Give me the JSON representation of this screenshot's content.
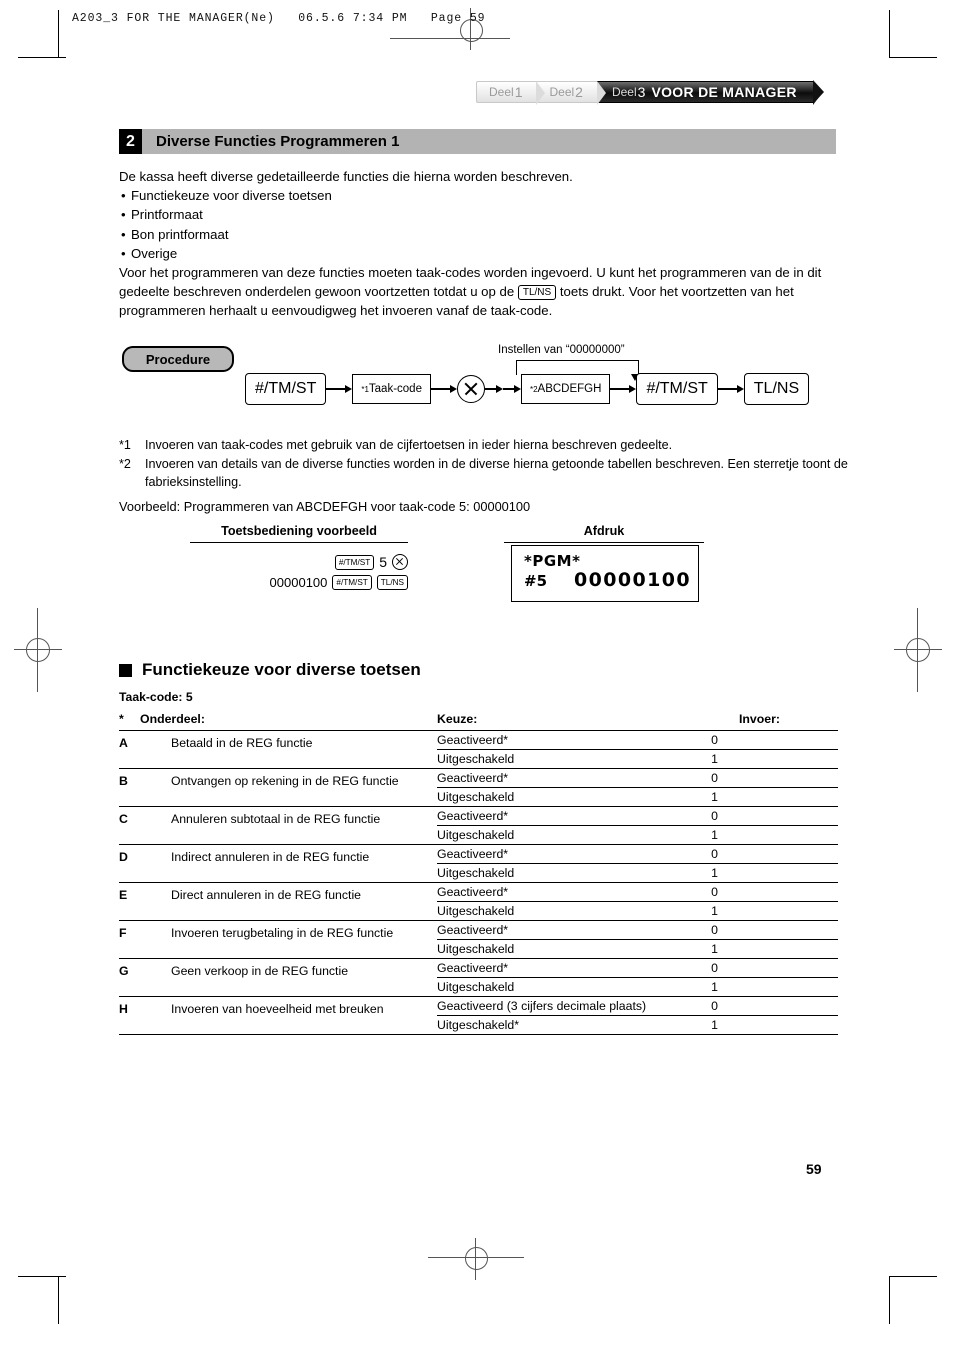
{
  "print_header": "A203_3 FOR THE MANAGER(Ne)   06.5.6 7:34 PM   Page 59",
  "header": {
    "tabs": [
      {
        "label": "Deel",
        "num": "1"
      },
      {
        "label": "Deel",
        "num": "2"
      },
      {
        "label": "Deel",
        "num": "3"
      }
    ],
    "title": "VOOR DE MANAGER"
  },
  "banner": {
    "number": "2",
    "title": "Diverse Functies Programmeren 1"
  },
  "intro": {
    "lead": "De kassa heeft diverse gedetailleerde functies die hierna worden beschreven.",
    "bullets": [
      "Functiekeuze voor diverse toetsen",
      "Printformaat",
      "Bon printformaat",
      "Overige"
    ],
    "para_1": "Voor het programmeren van deze functies moeten taak-codes worden ingevoerd. U kunt het programmeren van de in dit gedeelte beschreven onderdelen gewoon voortzetten totdat u op de",
    "key_tlns": "TL/NS",
    "para_2": "toets drukt. Voor het voortzetten van het programmeren herhaalt u eenvoudigweg het invoeren vanaf de taak-code."
  },
  "procedure": {
    "badge": "Procedure",
    "loop_label": "Instellen van “00000000”",
    "steps": {
      "step1": "#/TM/ST",
      "step2_sup": "*1",
      "step2": "Taak-code",
      "step3_icon": "multiply-circle-icon",
      "step4_sup": "*2",
      "step4": "ABCDEFGH",
      "step5": "#/TM/ST",
      "step6": "TL/NS"
    }
  },
  "notes": [
    {
      "mark": "*1",
      "text": "Invoeren van taak-codes met gebruik van de cijfertoetsen in ieder hierna beschreven gedeelte."
    },
    {
      "mark": "*2",
      "text": "Invoeren van details van de diverse functies worden in de diverse hierna getoonde tabellen beschreven. Een sterretje toont de fabrieksinstelling."
    }
  ],
  "voorbeeld": "Voorbeeld:  Programmeren van ABCDEFGH voor taak-code 5: 00000100",
  "example": {
    "left_heading": "Toetsbediening voorbeeld",
    "right_heading": "Afdruk",
    "keys_row1": [
      "#/TM/ST",
      "5",
      "multiply-circle-icon"
    ],
    "keys_row2_value": "00000100",
    "keys_row2": [
      "#/TM/ST",
      "TL/NS"
    ],
    "receipt": {
      "line1": "*PGM*",
      "line2_label": "#5",
      "line2_value": "00000100"
    }
  },
  "section": {
    "title": "Functiekeuze voor diverse toetsen",
    "taak_code_label": "Taak-code:",
    "taak_code_value": "5"
  },
  "table": {
    "headers": {
      "star": "*",
      "item": "Onderdeel:",
      "choice": "Keuze:",
      "entry": "Invoer:"
    },
    "rows": [
      {
        "letter": "A",
        "item": "Betaald in de REG functie",
        "options": [
          {
            "choice": "Geactiveerd*",
            "entry": "0"
          },
          {
            "choice": "Uitgeschakeld",
            "entry": "1"
          }
        ]
      },
      {
        "letter": "B",
        "item": "Ontvangen op rekening in de REG functie",
        "options": [
          {
            "choice": "Geactiveerd*",
            "entry": "0"
          },
          {
            "choice": "Uitgeschakeld",
            "entry": "1"
          }
        ]
      },
      {
        "letter": "C",
        "item": "Annuleren subtotaal in de REG functie",
        "options": [
          {
            "choice": "Geactiveerd*",
            "entry": "0"
          },
          {
            "choice": "Uitgeschakeld",
            "entry": "1"
          }
        ]
      },
      {
        "letter": "D",
        "item": "Indirect annuleren in de REG functie",
        "options": [
          {
            "choice": "Geactiveerd*",
            "entry": "0"
          },
          {
            "choice": "Uitgeschakeld",
            "entry": "1"
          }
        ]
      },
      {
        "letter": "E",
        "item": "Direct annuleren in de REG functie",
        "options": [
          {
            "choice": "Geactiveerd*",
            "entry": "0"
          },
          {
            "choice": "Uitgeschakeld",
            "entry": "1"
          }
        ]
      },
      {
        "letter": "F",
        "item": "Invoeren terugbetaling in de REG functie",
        "options": [
          {
            "choice": "Geactiveerd*",
            "entry": "0"
          },
          {
            "choice": "Uitgeschakeld",
            "entry": "1"
          }
        ]
      },
      {
        "letter": "G",
        "item": "Geen verkoop in de REG functie",
        "options": [
          {
            "choice": "Geactiveerd*",
            "entry": "0"
          },
          {
            "choice": "Uitgeschakeld",
            "entry": "1"
          }
        ]
      },
      {
        "letter": "H",
        "item": "Invoeren van hoeveelheid met breuken",
        "options": [
          {
            "choice": "Geactiveerd (3 cijfers decimale plaats)",
            "entry": "0"
          },
          {
            "choice": "Uitgeschakeld*",
            "entry": "1"
          }
        ]
      }
    ]
  },
  "page_number": "59"
}
